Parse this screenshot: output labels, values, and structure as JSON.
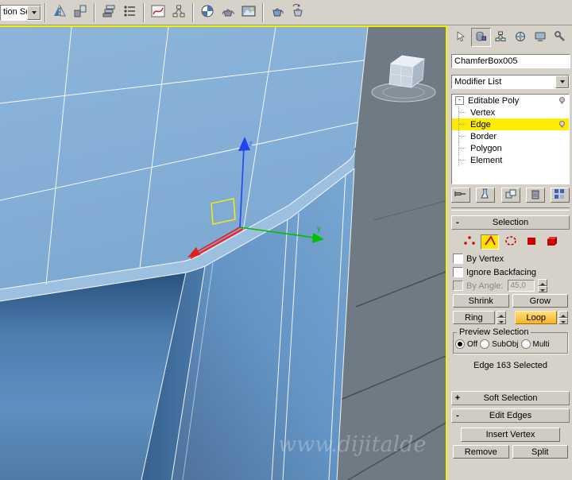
{
  "toolbar": {
    "selection_set_value": "tion Se",
    "icon_names": [
      "mirror",
      "align",
      "layer-manager",
      "scene-explorer",
      "curve-editor",
      "schematic-view",
      "material-editor",
      "render-setup",
      "rendered-frame-window",
      "render-production",
      "render-iterative"
    ]
  },
  "viewport": {
    "watermark": "www.dijitalde",
    "axis_y": "y",
    "axis_z": "z"
  },
  "command_panel": {
    "object_name": "ChamferBox005",
    "modifier_list_label": "Modifier List",
    "stack": {
      "root_label": "Editable Poly",
      "items": [
        "Vertex",
        "Edge",
        "Border",
        "Polygon",
        "Element"
      ],
      "selected_item": "Edge"
    },
    "selection": {
      "title": "Selection",
      "by_vertex_label": "By Vertex",
      "ignore_backfacing_label": "Ignore Backfacing",
      "by_angle_label": "By Angle:",
      "by_angle_value": "45,0",
      "shrink_label": "Shrink",
      "grow_label": "Grow",
      "ring_label": "Ring",
      "loop_label": "Loop",
      "preview_title": "Preview Selection",
      "preview_options": [
        "Off",
        "SubObj",
        "Multi"
      ],
      "preview_selected": "Off",
      "status_text": "Edge 163 Selected"
    },
    "soft_selection_title": "Soft Selection",
    "edit_edges_title": "Edit Edges",
    "insert_vertex_label": "Insert Vertex",
    "remove_label": "Remove",
    "split_label": "Split"
  },
  "glyphs": {
    "collapse": "-",
    "expand": "+"
  },
  "colors": {
    "active_viewport_border": "#f5f200",
    "stack_highlight": "#ffec00",
    "loop_highlight": "#f6b32a",
    "object_color_swatch": "#2a46ff",
    "subobject_red": "#cc0000"
  }
}
